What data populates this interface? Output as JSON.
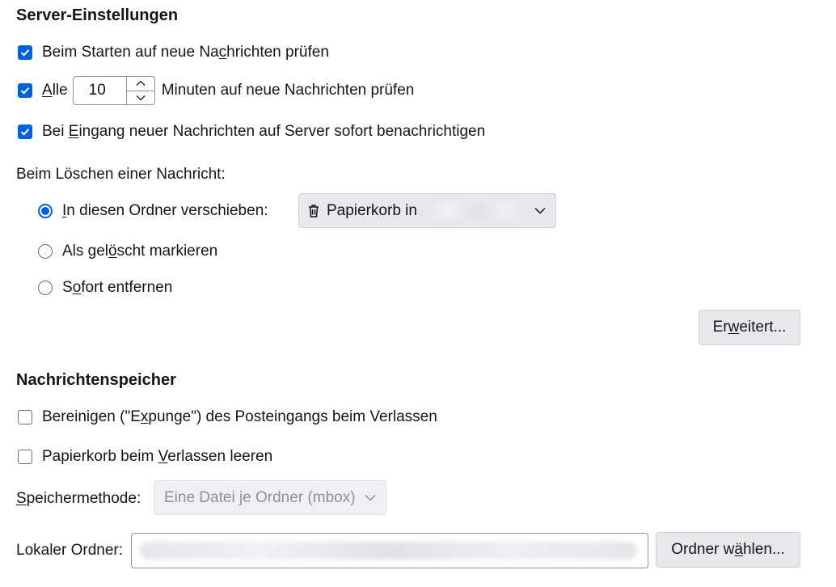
{
  "server": {
    "heading": "Server-Einstellungen",
    "check_on_start": {
      "pre": "Beim Starten auf neue Na",
      "key": "c",
      "post": "hrichten prüfen",
      "checked": true
    },
    "check_every": {
      "pre": "",
      "key": "A",
      "post": "lle",
      "checked": true,
      "minutes": "10",
      "suffix": "Minuten auf neue Nachrichten prüfen"
    },
    "notify": {
      "pre": "Bei ",
      "key": "E",
      "post": "ingang neuer Nachrichten auf Server sofort benachrichtigen",
      "checked": true
    },
    "delete_label": "Beim Löschen einer Nachricht:",
    "delete_options": [
      {
        "pre": "",
        "key": "I",
        "post": "n diesen Ordner verschieben:",
        "selected": true
      },
      {
        "pre": "Als gel",
        "key": "ö",
        "post": "scht markieren",
        "selected": false
      },
      {
        "pre": "S",
        "key": "o",
        "post": "fort entfernen",
        "selected": false
      }
    ],
    "trash_folder": "Papierkorb in",
    "advanced_button": {
      "pre": "Er",
      "key": "w",
      "post": "eitert..."
    }
  },
  "storage": {
    "heading": "Nachrichtenspeicher",
    "expunge": {
      "pre": "Bereinigen (\"E",
      "key": "x",
      "post": "punge\") des Posteingangs beim Verlassen",
      "checked": false
    },
    "empty_trash": {
      "pre": "Papierkorb beim ",
      "key": "V",
      "post": "erlassen leeren",
      "checked": false
    },
    "method_label": {
      "pre": "",
      "key": "S",
      "post": "peichermethode:"
    },
    "method_value": "Eine Datei je Ordner (mbox)",
    "local_folder_label": "Lokaler Ordner:",
    "choose_button": {
      "pre": "Ordner w",
      "key": "ä",
      "post": "hlen..."
    }
  },
  "colors": {
    "accent": "#0061e0",
    "button_bg": "#e9e9ed",
    "text": "#15141a"
  }
}
